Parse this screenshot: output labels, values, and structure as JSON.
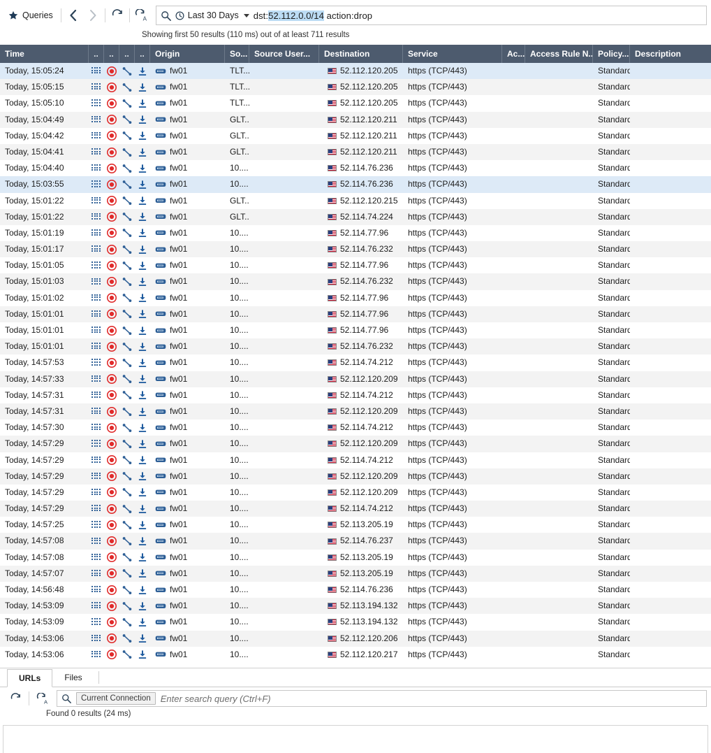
{
  "toolbar": {
    "queries_label": "Queries",
    "icons": {
      "star": "star-icon",
      "back": "back-chevron-icon",
      "forward": "forward-chevron-icon",
      "refresh": "refresh-icon",
      "auto_refresh": "auto-refresh-icon",
      "search": "search-icon",
      "clock": "clock-icon"
    }
  },
  "query": {
    "time_range": "Last 30 Days",
    "prefix": "dst:",
    "selected": "52.112.0.0/14",
    "suffix": " action:drop",
    "full_text": "dst:52.112.0.0/14 action:drop",
    "selection_color": "#bcdcf4"
  },
  "status": {
    "text": "Showing first 50 results (110 ms) out of at least 711 results"
  },
  "grid": {
    "header_bg": "#4d5b6e",
    "highlight_bg": "#ddeaf7",
    "columns": [
      {
        "key": "time",
        "label": "Time"
      },
      {
        "key": "n1",
        "label": ".."
      },
      {
        "key": "n2",
        "label": ".."
      },
      {
        "key": "n3",
        "label": ".."
      },
      {
        "key": "n4",
        "label": ".."
      },
      {
        "key": "origin",
        "label": "Origin"
      },
      {
        "key": "src",
        "label": "So..."
      },
      {
        "key": "user",
        "label": "Source User..."
      },
      {
        "key": "dst",
        "label": "Destination"
      },
      {
        "key": "svc",
        "label": "Service"
      },
      {
        "key": "act",
        "label": "Ac..."
      },
      {
        "key": "rule",
        "label": "Access Rule N..."
      },
      {
        "key": "pol",
        "label": "Policy..."
      },
      {
        "key": "desc",
        "label": "Description"
      }
    ],
    "row_icons": [
      "dot-grid-icon",
      "record-circle-icon",
      "connection-line-icon",
      "download-arrow-icon"
    ],
    "origin_icon": "firewall-device-icon",
    "destination_icon": "us-flag-icon",
    "rows": [
      {
        "time": "Today, 15:05:24",
        "origin": "fw01",
        "src": "TLT...",
        "user": "",
        "dst": "52.112.120.205",
        "svc": "https (TCP/443)",
        "act": "",
        "rule": "",
        "pol": "Standard",
        "desc": "",
        "highlight": true
      },
      {
        "time": "Today, 15:05:15",
        "origin": "fw01",
        "src": "TLT...",
        "user": "",
        "dst": "52.112.120.205",
        "svc": "https (TCP/443)",
        "act": "",
        "rule": "",
        "pol": "Standard",
        "desc": ""
      },
      {
        "time": "Today, 15:05:10",
        "origin": "fw01",
        "src": "TLT...",
        "user": "",
        "dst": "52.112.120.205",
        "svc": "https (TCP/443)",
        "act": "",
        "rule": "",
        "pol": "Standard",
        "desc": ""
      },
      {
        "time": "Today, 15:04:49",
        "origin": "fw01",
        "src": "GLT...",
        "user": "",
        "dst": "52.112.120.211",
        "svc": "https (TCP/443)",
        "act": "",
        "rule": "",
        "pol": "Standard",
        "desc": ""
      },
      {
        "time": "Today, 15:04:42",
        "origin": "fw01",
        "src": "GLT...",
        "user": "",
        "dst": "52.112.120.211",
        "svc": "https (TCP/443)",
        "act": "",
        "rule": "",
        "pol": "Standard",
        "desc": ""
      },
      {
        "time": "Today, 15:04:41",
        "origin": "fw01",
        "src": "GLT...",
        "user": "",
        "dst": "52.112.120.211",
        "svc": "https (TCP/443)",
        "act": "",
        "rule": "",
        "pol": "Standard",
        "desc": ""
      },
      {
        "time": "Today, 15:04:40",
        "origin": "fw01",
        "src": "10....",
        "user": "",
        "dst": "52.114.76.236",
        "svc": "https (TCP/443)",
        "act": "",
        "rule": "",
        "pol": "Standard",
        "desc": ""
      },
      {
        "time": "Today, 15:03:55",
        "origin": "fw01",
        "src": "10....",
        "user": "",
        "dst": "52.114.76.236",
        "svc": "https (TCP/443)",
        "act": "",
        "rule": "",
        "pol": "Standard",
        "desc": "",
        "highlight": true
      },
      {
        "time": "Today, 15:01:22",
        "origin": "fw01",
        "src": "GLT...",
        "user": "",
        "dst": "52.112.120.215",
        "svc": "https (TCP/443)",
        "act": "",
        "rule": "",
        "pol": "Standard",
        "desc": ""
      },
      {
        "time": "Today, 15:01:22",
        "origin": "fw01",
        "src": "GLT...",
        "user": "",
        "dst": "52.114.74.224",
        "svc": "https (TCP/443)",
        "act": "",
        "rule": "",
        "pol": "Standard",
        "desc": ""
      },
      {
        "time": "Today, 15:01:19",
        "origin": "fw01",
        "src": "10....",
        "user": "",
        "dst": "52.114.77.96",
        "svc": "https (TCP/443)",
        "act": "",
        "rule": "",
        "pol": "Standard",
        "desc": ""
      },
      {
        "time": "Today, 15:01:17",
        "origin": "fw01",
        "src": "10....",
        "user": "",
        "dst": "52.114.76.232",
        "svc": "https (TCP/443)",
        "act": "",
        "rule": "",
        "pol": "Standard",
        "desc": ""
      },
      {
        "time": "Today, 15:01:05",
        "origin": "fw01",
        "src": "10....",
        "user": "",
        "dst": "52.114.77.96",
        "svc": "https (TCP/443)",
        "act": "",
        "rule": "",
        "pol": "Standard",
        "desc": ""
      },
      {
        "time": "Today, 15:01:03",
        "origin": "fw01",
        "src": "10....",
        "user": "",
        "dst": "52.114.76.232",
        "svc": "https (TCP/443)",
        "act": "",
        "rule": "",
        "pol": "Standard",
        "desc": ""
      },
      {
        "time": "Today, 15:01:02",
        "origin": "fw01",
        "src": "10....",
        "user": "",
        "dst": "52.114.77.96",
        "svc": "https (TCP/443)",
        "act": "",
        "rule": "",
        "pol": "Standard",
        "desc": ""
      },
      {
        "time": "Today, 15:01:01",
        "origin": "fw01",
        "src": "10....",
        "user": "",
        "dst": "52.114.77.96",
        "svc": "https (TCP/443)",
        "act": "",
        "rule": "",
        "pol": "Standard",
        "desc": ""
      },
      {
        "time": "Today, 15:01:01",
        "origin": "fw01",
        "src": "10....",
        "user": "",
        "dst": "52.114.77.96",
        "svc": "https (TCP/443)",
        "act": "",
        "rule": "",
        "pol": "Standard",
        "desc": ""
      },
      {
        "time": "Today, 15:01:01",
        "origin": "fw01",
        "src": "10....",
        "user": "",
        "dst": "52.114.76.232",
        "svc": "https (TCP/443)",
        "act": "",
        "rule": "",
        "pol": "Standard",
        "desc": ""
      },
      {
        "time": "Today, 14:57:53",
        "origin": "fw01",
        "src": "10....",
        "user": "",
        "dst": "52.114.74.212",
        "svc": "https (TCP/443)",
        "act": "",
        "rule": "",
        "pol": "Standard",
        "desc": ""
      },
      {
        "time": "Today, 14:57:33",
        "origin": "fw01",
        "src": "10....",
        "user": "",
        "dst": "52.112.120.209",
        "svc": "https (TCP/443)",
        "act": "",
        "rule": "",
        "pol": "Standard",
        "desc": ""
      },
      {
        "time": "Today, 14:57:31",
        "origin": "fw01",
        "src": "10....",
        "user": "",
        "dst": "52.114.74.212",
        "svc": "https (TCP/443)",
        "act": "",
        "rule": "",
        "pol": "Standard",
        "desc": ""
      },
      {
        "time": "Today, 14:57:31",
        "origin": "fw01",
        "src": "10....",
        "user": "",
        "dst": "52.112.120.209",
        "svc": "https (TCP/443)",
        "act": "",
        "rule": "",
        "pol": "Standard",
        "desc": ""
      },
      {
        "time": "Today, 14:57:30",
        "origin": "fw01",
        "src": "10....",
        "user": "",
        "dst": "52.114.74.212",
        "svc": "https (TCP/443)",
        "act": "",
        "rule": "",
        "pol": "Standard",
        "desc": ""
      },
      {
        "time": "Today, 14:57:29",
        "origin": "fw01",
        "src": "10....",
        "user": "",
        "dst": "52.112.120.209",
        "svc": "https (TCP/443)",
        "act": "",
        "rule": "",
        "pol": "Standard",
        "desc": ""
      },
      {
        "time": "Today, 14:57:29",
        "origin": "fw01",
        "src": "10....",
        "user": "",
        "dst": "52.114.74.212",
        "svc": "https (TCP/443)",
        "act": "",
        "rule": "",
        "pol": "Standard",
        "desc": ""
      },
      {
        "time": "Today, 14:57:29",
        "origin": "fw01",
        "src": "10....",
        "user": "",
        "dst": "52.112.120.209",
        "svc": "https (TCP/443)",
        "act": "",
        "rule": "",
        "pol": "Standard",
        "desc": ""
      },
      {
        "time": "Today, 14:57:29",
        "origin": "fw01",
        "src": "10....",
        "user": "",
        "dst": "52.112.120.209",
        "svc": "https (TCP/443)",
        "act": "",
        "rule": "",
        "pol": "Standard",
        "desc": ""
      },
      {
        "time": "Today, 14:57:29",
        "origin": "fw01",
        "src": "10....",
        "user": "",
        "dst": "52.114.74.212",
        "svc": "https (TCP/443)",
        "act": "",
        "rule": "",
        "pol": "Standard",
        "desc": ""
      },
      {
        "time": "Today, 14:57:25",
        "origin": "fw01",
        "src": "10....",
        "user": "",
        "dst": "52.113.205.19",
        "svc": "https (TCP/443)",
        "act": "",
        "rule": "",
        "pol": "Standard",
        "desc": ""
      },
      {
        "time": "Today, 14:57:08",
        "origin": "fw01",
        "src": "10....",
        "user": "",
        "dst": "52.114.76.237",
        "svc": "https (TCP/443)",
        "act": "",
        "rule": "",
        "pol": "Standard",
        "desc": ""
      },
      {
        "time": "Today, 14:57:08",
        "origin": "fw01",
        "src": "10....",
        "user": "",
        "dst": "52.113.205.19",
        "svc": "https (TCP/443)",
        "act": "",
        "rule": "",
        "pol": "Standard",
        "desc": ""
      },
      {
        "time": "Today, 14:57:07",
        "origin": "fw01",
        "src": "10....",
        "user": "",
        "dst": "52.113.205.19",
        "svc": "https (TCP/443)",
        "act": "",
        "rule": "",
        "pol": "Standard",
        "desc": ""
      },
      {
        "time": "Today, 14:56:48",
        "origin": "fw01",
        "src": "10....",
        "user": "",
        "dst": "52.114.76.236",
        "svc": "https (TCP/443)",
        "act": "",
        "rule": "",
        "pol": "Standard",
        "desc": ""
      },
      {
        "time": "Today, 14:53:09",
        "origin": "fw01",
        "src": "10....",
        "user": "",
        "dst": "52.113.194.132",
        "svc": "https (TCP/443)",
        "act": "",
        "rule": "",
        "pol": "Standard",
        "desc": ""
      },
      {
        "time": "Today, 14:53:09",
        "origin": "fw01",
        "src": "10....",
        "user": "",
        "dst": "52.113.194.132",
        "svc": "https (TCP/443)",
        "act": "",
        "rule": "",
        "pol": "Standard",
        "desc": ""
      },
      {
        "time": "Today, 14:53:06",
        "origin": "fw01",
        "src": "10....",
        "user": "",
        "dst": "52.112.120.206",
        "svc": "https (TCP/443)",
        "act": "",
        "rule": "",
        "pol": "Standard",
        "desc": ""
      },
      {
        "time": "Today, 14:53:06",
        "origin": "fw01",
        "src": "10....",
        "user": "",
        "dst": "52.112.120.217",
        "svc": "https (TCP/443)",
        "act": "",
        "rule": "",
        "pol": "Standard",
        "desc": ""
      }
    ]
  },
  "bottom_panel": {
    "tabs": [
      {
        "label": "URLs",
        "active": true
      },
      {
        "label": "Files",
        "active": false
      }
    ],
    "icons": {
      "refresh": "refresh-icon",
      "auto_refresh": "auto-refresh-icon",
      "search": "search-icon"
    },
    "scope_chip": "Current Connection",
    "search_placeholder": "Enter search query (Ctrl+F)",
    "found_text": "Found 0 results (24 ms)"
  }
}
